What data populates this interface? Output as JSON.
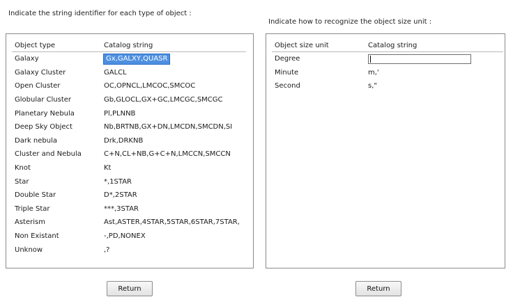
{
  "left": {
    "heading": "Indicate the string identifier for each type of object :",
    "columns": [
      "Object type",
      "Catalog string"
    ],
    "rows": [
      {
        "type": "Galaxy",
        "catalog": "Gx,GALXY,QUASR",
        "selected": true
      },
      {
        "type": "Galaxy Cluster",
        "catalog": "GALCL"
      },
      {
        "type": "Open Cluster",
        "catalog": "OC,OPNCL,LMCOC,SMCOC"
      },
      {
        "type": "Globular Cluster",
        "catalog": "Gb,GLOCL,GX+GC,LMCGC,SMCGC"
      },
      {
        "type": "Planetary Nebula",
        "catalog": "Pl,PLNNB"
      },
      {
        "type": "Deep Sky Object",
        "catalog": "Nb,BRTNB,GX+DN,LMCDN,SMCDN,SI"
      },
      {
        "type": "Dark nebula",
        "catalog": "Drk,DRKNB"
      },
      {
        "type": "Cluster and Nebula",
        "catalog": "C+N,CL+NB,G+C+N,LMCCN,SMCCN"
      },
      {
        "type": "Knot",
        "catalog": "Kt"
      },
      {
        "type": "Star",
        "catalog": "*,1STAR"
      },
      {
        "type": "Double Star",
        "catalog": "D*,2STAR"
      },
      {
        "type": "Triple Star",
        "catalog": "***,3STAR"
      },
      {
        "type": "Asterism",
        "catalog": "Ast,ASTER,4STAR,5STAR,6STAR,7STAR,"
      },
      {
        "type": "Non Existant",
        "catalog": "-,PD,NONEX"
      },
      {
        "type": "Unknow",
        "catalog": ",?"
      }
    ],
    "button": "Return"
  },
  "right": {
    "heading": "Indicate how to recognize the object size unit :",
    "columns": [
      "Object size unit",
      "Catalog string"
    ],
    "rows": [
      {
        "unit": "Degree",
        "catalog": "",
        "editing": true
      },
      {
        "unit": "Minute",
        "catalog": "m,'"
      },
      {
        "unit": "Second",
        "catalog": "s,\""
      }
    ],
    "button": "Return"
  }
}
